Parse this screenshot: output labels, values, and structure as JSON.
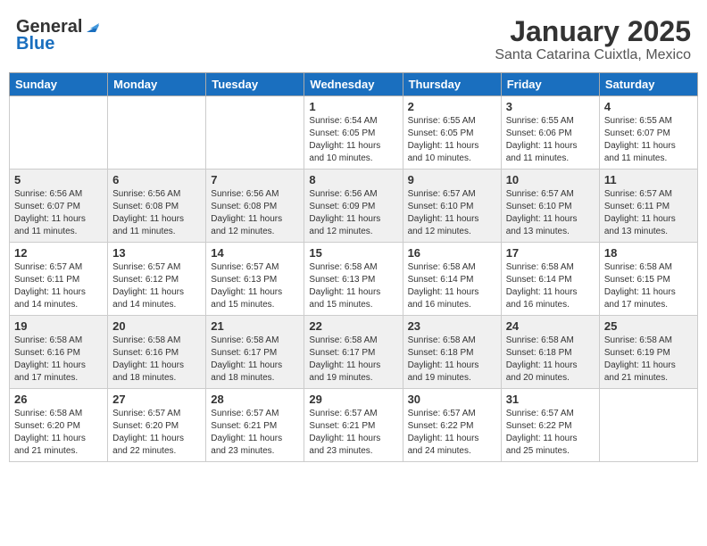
{
  "logo": {
    "general": "General",
    "blue": "Blue"
  },
  "header": {
    "title": "January 2025",
    "subtitle": "Santa Catarina Cuixtla, Mexico"
  },
  "weekdays": [
    "Sunday",
    "Monday",
    "Tuesday",
    "Wednesday",
    "Thursday",
    "Friday",
    "Saturday"
  ],
  "weeks": [
    [
      {
        "day": "",
        "info": ""
      },
      {
        "day": "",
        "info": ""
      },
      {
        "day": "",
        "info": ""
      },
      {
        "day": "1",
        "info": "Sunrise: 6:54 AM\nSunset: 6:05 PM\nDaylight: 11 hours and 10 minutes."
      },
      {
        "day": "2",
        "info": "Sunrise: 6:55 AM\nSunset: 6:05 PM\nDaylight: 11 hours and 10 minutes."
      },
      {
        "day": "3",
        "info": "Sunrise: 6:55 AM\nSunset: 6:06 PM\nDaylight: 11 hours and 11 minutes."
      },
      {
        "day": "4",
        "info": "Sunrise: 6:55 AM\nSunset: 6:07 PM\nDaylight: 11 hours and 11 minutes."
      }
    ],
    [
      {
        "day": "5",
        "info": "Sunrise: 6:56 AM\nSunset: 6:07 PM\nDaylight: 11 hours and 11 minutes."
      },
      {
        "day": "6",
        "info": "Sunrise: 6:56 AM\nSunset: 6:08 PM\nDaylight: 11 hours and 11 minutes."
      },
      {
        "day": "7",
        "info": "Sunrise: 6:56 AM\nSunset: 6:08 PM\nDaylight: 11 hours and 12 minutes."
      },
      {
        "day": "8",
        "info": "Sunrise: 6:56 AM\nSunset: 6:09 PM\nDaylight: 11 hours and 12 minutes."
      },
      {
        "day": "9",
        "info": "Sunrise: 6:57 AM\nSunset: 6:10 PM\nDaylight: 11 hours and 12 minutes."
      },
      {
        "day": "10",
        "info": "Sunrise: 6:57 AM\nSunset: 6:10 PM\nDaylight: 11 hours and 13 minutes."
      },
      {
        "day": "11",
        "info": "Sunrise: 6:57 AM\nSunset: 6:11 PM\nDaylight: 11 hours and 13 minutes."
      }
    ],
    [
      {
        "day": "12",
        "info": "Sunrise: 6:57 AM\nSunset: 6:11 PM\nDaylight: 11 hours and 14 minutes."
      },
      {
        "day": "13",
        "info": "Sunrise: 6:57 AM\nSunset: 6:12 PM\nDaylight: 11 hours and 14 minutes."
      },
      {
        "day": "14",
        "info": "Sunrise: 6:57 AM\nSunset: 6:13 PM\nDaylight: 11 hours and 15 minutes."
      },
      {
        "day": "15",
        "info": "Sunrise: 6:58 AM\nSunset: 6:13 PM\nDaylight: 11 hours and 15 minutes."
      },
      {
        "day": "16",
        "info": "Sunrise: 6:58 AM\nSunset: 6:14 PM\nDaylight: 11 hours and 16 minutes."
      },
      {
        "day": "17",
        "info": "Sunrise: 6:58 AM\nSunset: 6:14 PM\nDaylight: 11 hours and 16 minutes."
      },
      {
        "day": "18",
        "info": "Sunrise: 6:58 AM\nSunset: 6:15 PM\nDaylight: 11 hours and 17 minutes."
      }
    ],
    [
      {
        "day": "19",
        "info": "Sunrise: 6:58 AM\nSunset: 6:16 PM\nDaylight: 11 hours and 17 minutes."
      },
      {
        "day": "20",
        "info": "Sunrise: 6:58 AM\nSunset: 6:16 PM\nDaylight: 11 hours and 18 minutes."
      },
      {
        "day": "21",
        "info": "Sunrise: 6:58 AM\nSunset: 6:17 PM\nDaylight: 11 hours and 18 minutes."
      },
      {
        "day": "22",
        "info": "Sunrise: 6:58 AM\nSunset: 6:17 PM\nDaylight: 11 hours and 19 minutes."
      },
      {
        "day": "23",
        "info": "Sunrise: 6:58 AM\nSunset: 6:18 PM\nDaylight: 11 hours and 19 minutes."
      },
      {
        "day": "24",
        "info": "Sunrise: 6:58 AM\nSunset: 6:18 PM\nDaylight: 11 hours and 20 minutes."
      },
      {
        "day": "25",
        "info": "Sunrise: 6:58 AM\nSunset: 6:19 PM\nDaylight: 11 hours and 21 minutes."
      }
    ],
    [
      {
        "day": "26",
        "info": "Sunrise: 6:58 AM\nSunset: 6:20 PM\nDaylight: 11 hours and 21 minutes."
      },
      {
        "day": "27",
        "info": "Sunrise: 6:57 AM\nSunset: 6:20 PM\nDaylight: 11 hours and 22 minutes."
      },
      {
        "day": "28",
        "info": "Sunrise: 6:57 AM\nSunset: 6:21 PM\nDaylight: 11 hours and 23 minutes."
      },
      {
        "day": "29",
        "info": "Sunrise: 6:57 AM\nSunset: 6:21 PM\nDaylight: 11 hours and 23 minutes."
      },
      {
        "day": "30",
        "info": "Sunrise: 6:57 AM\nSunset: 6:22 PM\nDaylight: 11 hours and 24 minutes."
      },
      {
        "day": "31",
        "info": "Sunrise: 6:57 AM\nSunset: 6:22 PM\nDaylight: 11 hours and 25 minutes."
      },
      {
        "day": "",
        "info": ""
      }
    ]
  ],
  "colors": {
    "header_bg": "#1a6fbf",
    "row_shaded": "#f0f0f0",
    "row_white": "#ffffff"
  }
}
